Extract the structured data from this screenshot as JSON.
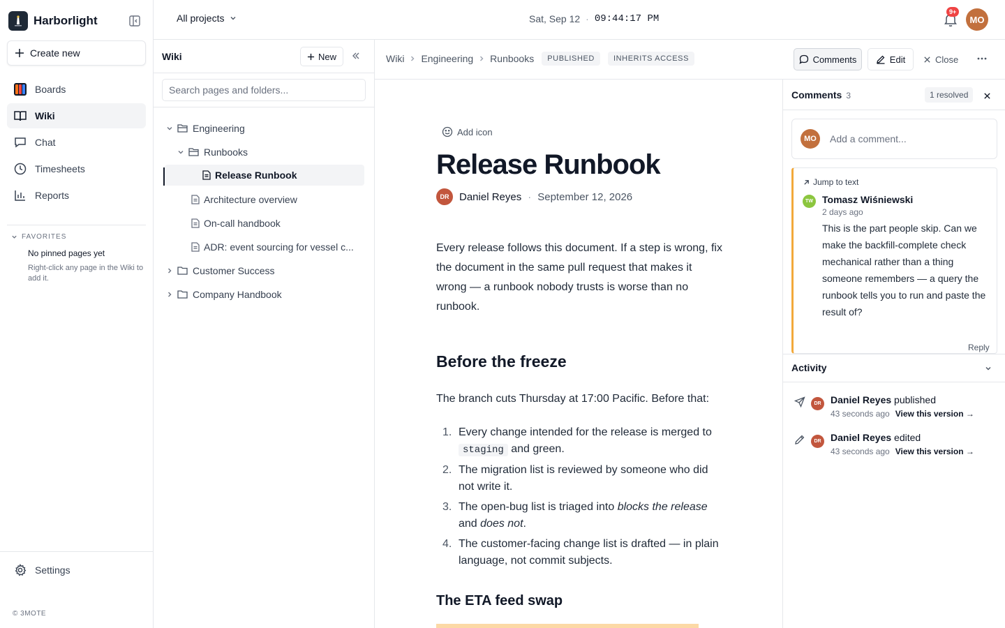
{
  "app": {
    "name": "Harborlight",
    "create_label": "Create new",
    "copyright": "© 3MOTE"
  },
  "nav": [
    {
      "label": "Boards",
      "icon": "boards-icon",
      "active": false
    },
    {
      "label": "Wiki",
      "icon": "book-icon",
      "active": true
    },
    {
      "label": "Chat",
      "icon": "chat-icon",
      "active": false
    },
    {
      "label": "Timesheets",
      "icon": "clock-icon",
      "active": false
    },
    {
      "label": "Reports",
      "icon": "bar-chart-icon",
      "active": false
    }
  ],
  "favorites": {
    "heading": "FAVORITES",
    "empty": "No pinned pages yet",
    "hint": "Right-click any page in the Wiki to add it."
  },
  "settings_label": "Settings",
  "topbar": {
    "project": "All projects",
    "date": "Sat, Sep 12",
    "sep": "·",
    "time": "09:44:17 PM",
    "badge": "9+",
    "user_initials": "MO"
  },
  "tree": {
    "title": "Wiki",
    "new_label": "New",
    "search_placeholder": "Search pages and folders...",
    "items": [
      {
        "label": "Engineering",
        "type": "folder",
        "expanded": true
      },
      {
        "label": "Runbooks",
        "type": "folder",
        "expanded": true
      },
      {
        "label": "Release Runbook",
        "type": "page",
        "selected": true
      },
      {
        "label": "Architecture overview",
        "type": "page"
      },
      {
        "label": "On-call handbook",
        "type": "page"
      },
      {
        "label": "ADR: event sourcing for vessel c...",
        "type": "page"
      },
      {
        "label": "Customer Success",
        "type": "folder",
        "expanded": false
      },
      {
        "label": "Company Handbook",
        "type": "folder",
        "expanded": false
      }
    ]
  },
  "breadcrumb": [
    "Wiki",
    "Engineering",
    "Runbooks"
  ],
  "tags": [
    "PUBLISHED",
    "INHERITS ACCESS"
  ],
  "toolbar": {
    "comments": "Comments",
    "edit": "Edit",
    "close": "Close"
  },
  "doc": {
    "add_icon": "Add icon",
    "title": "Release Runbook",
    "author": "Daniel Reyes",
    "author_initials": "DR",
    "sep": "·",
    "date": "September 12, 2026",
    "intro": "Every release follows this document. If a step is wrong, fix the document in the same pull request that makes it wrong — a runbook nobody trusts is worse than no runbook.",
    "h2_freeze": "Before the freeze",
    "freeze_intro": "The branch cuts Thursday at 17:00 Pacific. Before that:",
    "list": [
      {
        "n": "1.",
        "pre": "Every change intended for the release is merged to ",
        "code": "staging",
        "post": " and green."
      },
      {
        "n": "2.",
        "text": "The migration list is reviewed by someone who did not write it."
      },
      {
        "n": "3.",
        "pre": "The open-bug list is triaged into ",
        "em1": "blocks the release",
        "mid": " and ",
        "em2": "does not",
        "post": "."
      },
      {
        "n": "4.",
        "text": "The customer-facing change list is drafted — in plain language, not commit subjects."
      }
    ],
    "h2_eta": "The ETA feed swap"
  },
  "comments": {
    "title": "Comments",
    "count": "3",
    "resolved": "1 resolved",
    "placeholder": "Add a comment...",
    "user_initials": "MO",
    "thread": {
      "jump": "Jump to text",
      "author": "Tomasz Wiśniewski",
      "initials": "TW",
      "time": "2 days ago",
      "body": "This is the part people skip. Can we make the backfill-complete check mechanical rather than a thing someone remembers — a query the runbook tells you to run and paste the result of?",
      "reply": "Reply"
    }
  },
  "activity": {
    "title": "Activity",
    "items": [
      {
        "icon": "send-icon",
        "who": "Daniel Reyes",
        "action": " published",
        "when": "43 seconds ago",
        "link": "View this version →",
        "initials": "DR"
      },
      {
        "icon": "pencil-icon",
        "who": "Daniel Reyes",
        "action": " edited",
        "when": "43 seconds ago",
        "link": "View this version →",
        "initials": "DR"
      }
    ]
  }
}
